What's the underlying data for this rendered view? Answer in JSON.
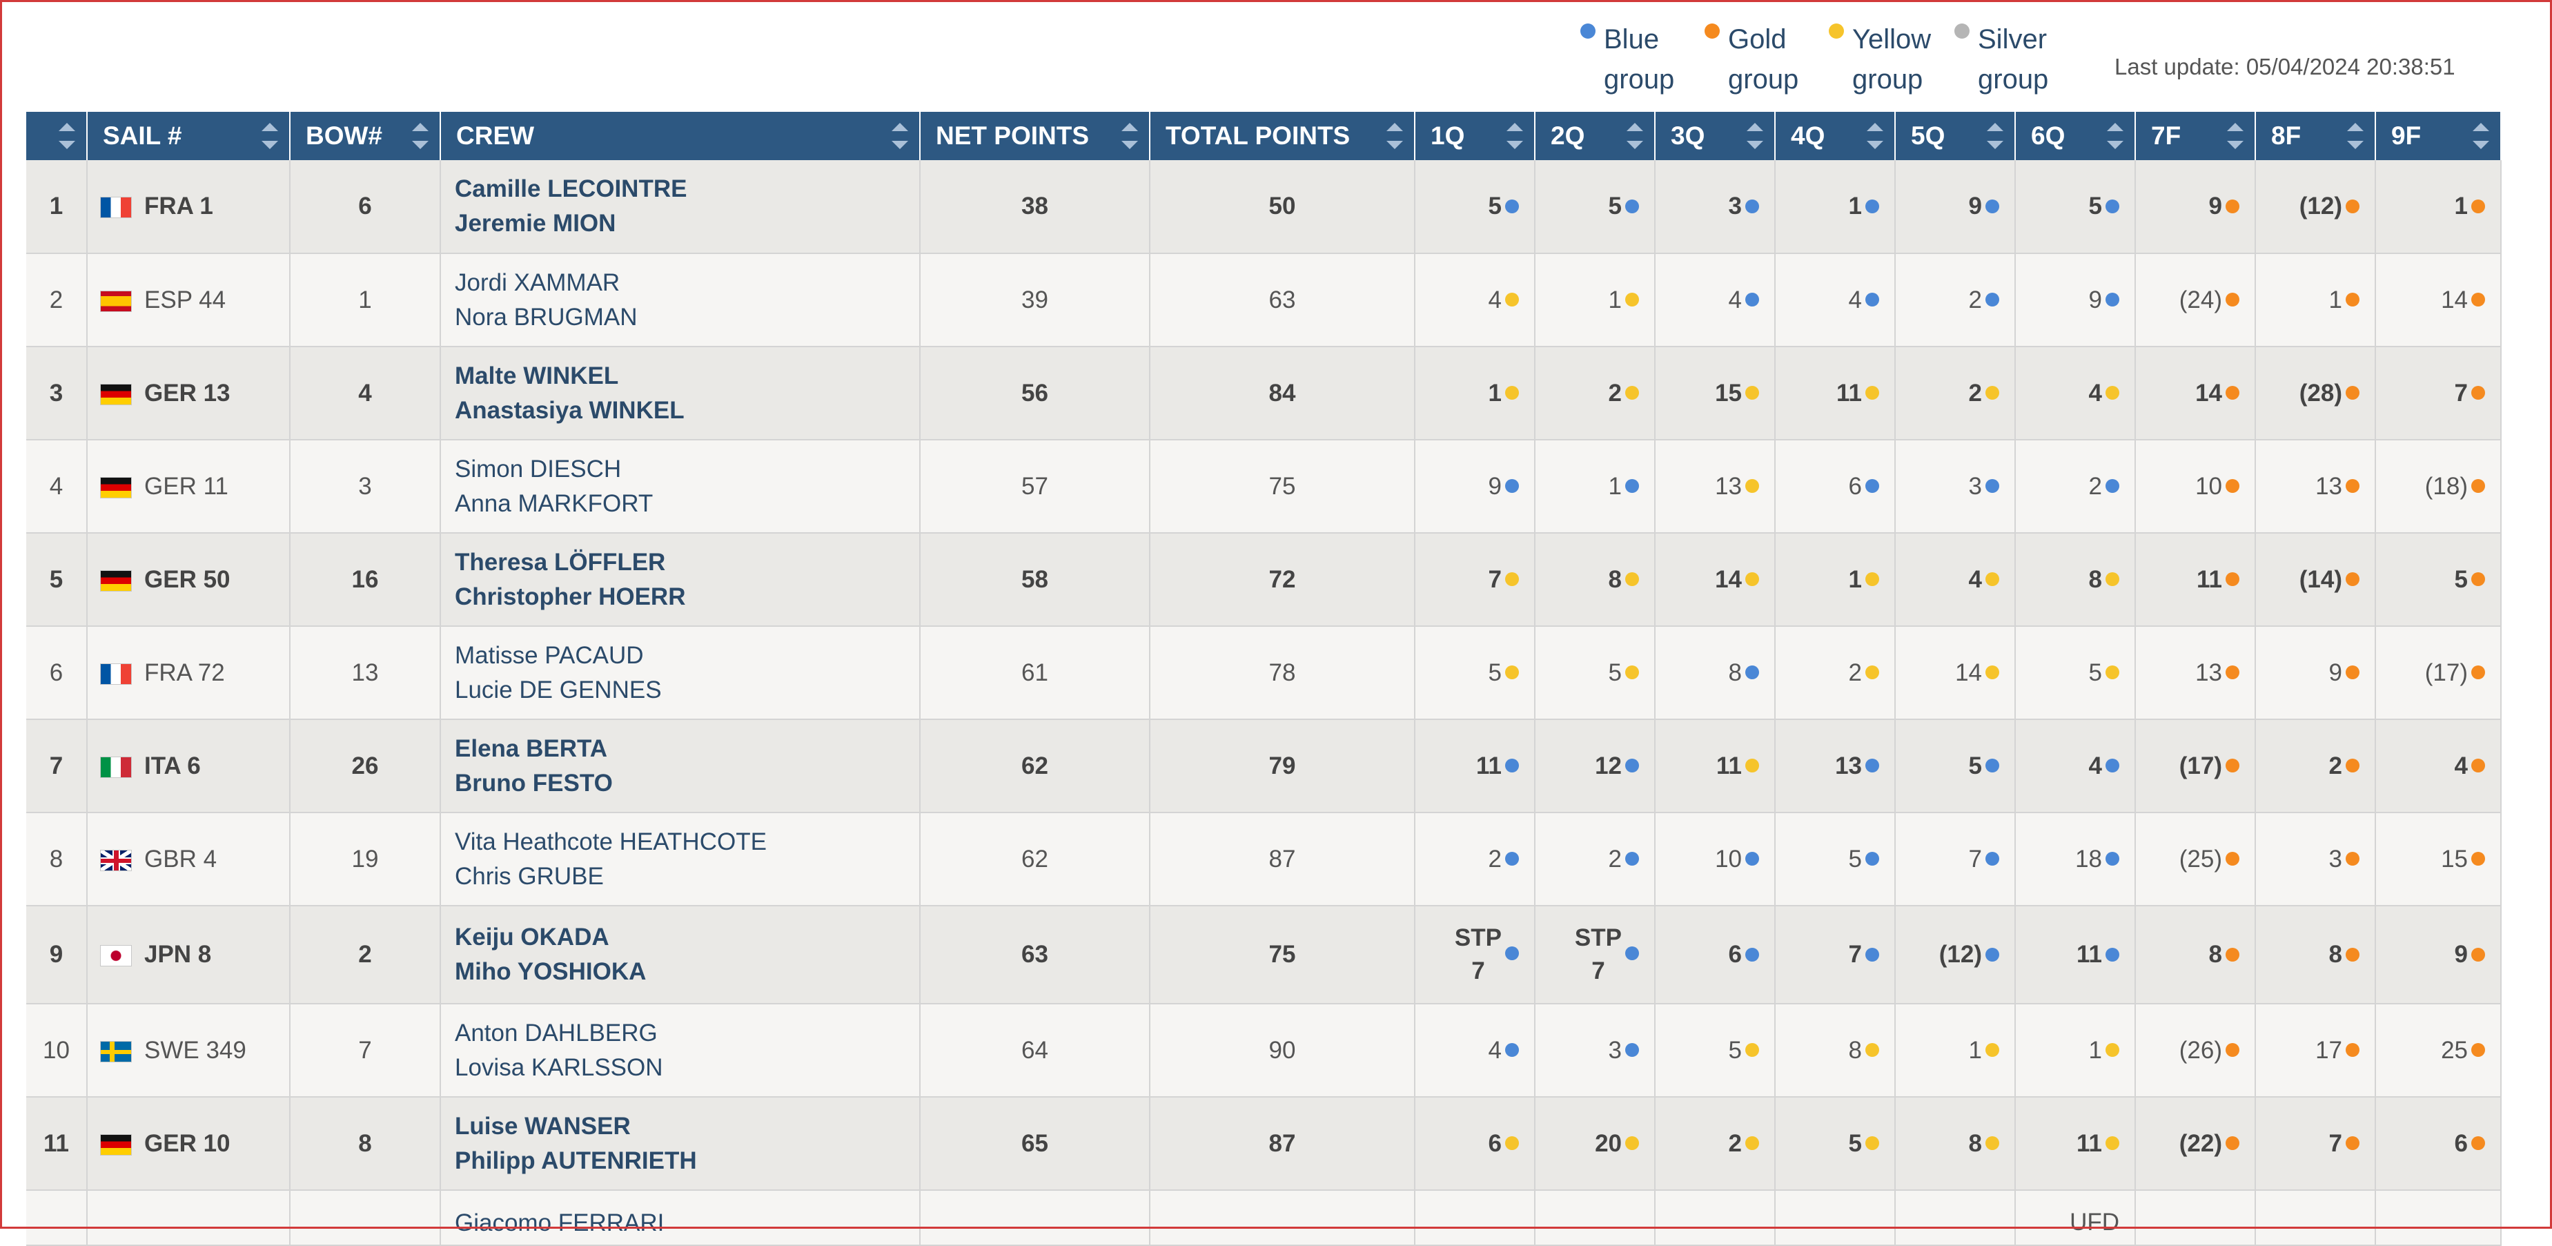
{
  "colors": {
    "header_bg": "#2d5882",
    "blue": "#4a87d6",
    "gold": "#f58a1f",
    "yellow": "#f6c42b",
    "silver": "#b5b5b5",
    "crew_text": "#2b4a6a"
  },
  "legend": [
    {
      "icon": "blue-dot",
      "line1": "Blue",
      "line2": "group",
      "color": "#4a87d6"
    },
    {
      "icon": "gold-dot",
      "line1": "Gold",
      "line2": "group",
      "color": "#f58a1f"
    },
    {
      "icon": "yellow-dot",
      "line1": "Yellow",
      "line2": "group",
      "color": "#f6c42b"
    },
    {
      "icon": "silver-dot",
      "line1": "Silver",
      "line2": "group",
      "color": "#b5b5b5"
    }
  ],
  "last_update": "Last update: 05/04/2024 20:38:51",
  "table": {
    "headers": [
      "",
      "SAIL #",
      "BOW#",
      "CREW",
      "NET POINTS",
      "TOTAL POINTS",
      "1Q",
      "2Q",
      "3Q",
      "4Q",
      "5Q",
      "6Q",
      "7F",
      "8F",
      "9F"
    ],
    "rows": [
      {
        "rank": "1",
        "flag": "fra",
        "sail": "FRA 1",
        "bow": "6",
        "crew": [
          "Camille LECOINTRE",
          "Jeremie MION"
        ],
        "net": "38",
        "total": "50",
        "races": [
          [
            "5",
            "blue"
          ],
          [
            "5",
            "blue"
          ],
          [
            "3",
            "blue"
          ],
          [
            "1",
            "blue"
          ],
          [
            "9",
            "blue"
          ],
          [
            "5",
            "blue"
          ],
          [
            "9",
            "gold"
          ],
          [
            "(12)",
            "gold"
          ],
          [
            "1",
            "gold"
          ]
        ]
      },
      {
        "rank": "2",
        "flag": "esp",
        "sail": "ESP 44",
        "bow": "1",
        "crew": [
          "Jordi XAMMAR",
          "Nora BRUGMAN"
        ],
        "net": "39",
        "total": "63",
        "races": [
          [
            "4",
            "yellow"
          ],
          [
            "1",
            "yellow"
          ],
          [
            "4",
            "blue"
          ],
          [
            "4",
            "blue"
          ],
          [
            "2",
            "blue"
          ],
          [
            "9",
            "blue"
          ],
          [
            "(24)",
            "gold"
          ],
          [
            "1",
            "gold"
          ],
          [
            "14",
            "gold"
          ]
        ]
      },
      {
        "rank": "3",
        "flag": "ger",
        "sail": "GER 13",
        "bow": "4",
        "crew": [
          "Malte WINKEL",
          "Anastasiya WINKEL"
        ],
        "net": "56",
        "total": "84",
        "races": [
          [
            "1",
            "yellow"
          ],
          [
            "2",
            "yellow"
          ],
          [
            "15",
            "yellow"
          ],
          [
            "11",
            "yellow"
          ],
          [
            "2",
            "yellow"
          ],
          [
            "4",
            "yellow"
          ],
          [
            "14",
            "gold"
          ],
          [
            "(28)",
            "gold"
          ],
          [
            "7",
            "gold"
          ]
        ]
      },
      {
        "rank": "4",
        "flag": "ger",
        "sail": "GER 11",
        "bow": "3",
        "crew": [
          "Simon DIESCH",
          "Anna MARKFORT"
        ],
        "net": "57",
        "total": "75",
        "races": [
          [
            "9",
            "blue"
          ],
          [
            "1",
            "blue"
          ],
          [
            "13",
            "yellow"
          ],
          [
            "6",
            "blue"
          ],
          [
            "3",
            "blue"
          ],
          [
            "2",
            "blue"
          ],
          [
            "10",
            "gold"
          ],
          [
            "13",
            "gold"
          ],
          [
            "(18)",
            "gold"
          ]
        ]
      },
      {
        "rank": "5",
        "flag": "ger",
        "sail": "GER 50",
        "bow": "16",
        "crew": [
          "Theresa LÖFFLER",
          "Christopher HOERR"
        ],
        "net": "58",
        "total": "72",
        "races": [
          [
            "7",
            "yellow"
          ],
          [
            "8",
            "yellow"
          ],
          [
            "14",
            "yellow"
          ],
          [
            "1",
            "yellow"
          ],
          [
            "4",
            "yellow"
          ],
          [
            "8",
            "yellow"
          ],
          [
            "11",
            "gold"
          ],
          [
            "(14)",
            "gold"
          ],
          [
            "5",
            "gold"
          ]
        ]
      },
      {
        "rank": "6",
        "flag": "fra",
        "sail": "FRA 72",
        "bow": "13",
        "crew": [
          "Matisse PACAUD",
          "Lucie DE GENNES"
        ],
        "net": "61",
        "total": "78",
        "races": [
          [
            "5",
            "yellow"
          ],
          [
            "5",
            "yellow"
          ],
          [
            "8",
            "blue"
          ],
          [
            "2",
            "yellow"
          ],
          [
            "14",
            "yellow"
          ],
          [
            "5",
            "yellow"
          ],
          [
            "13",
            "gold"
          ],
          [
            "9",
            "gold"
          ],
          [
            "(17)",
            "gold"
          ]
        ]
      },
      {
        "rank": "7",
        "flag": "ita",
        "sail": "ITA 6",
        "bow": "26",
        "crew": [
          "Elena BERTA",
          "Bruno FESTO"
        ],
        "net": "62",
        "total": "79",
        "races": [
          [
            "11",
            "blue"
          ],
          [
            "12",
            "blue"
          ],
          [
            "11",
            "yellow"
          ],
          [
            "13",
            "blue"
          ],
          [
            "5",
            "blue"
          ],
          [
            "4",
            "blue"
          ],
          [
            "(17)",
            "gold"
          ],
          [
            "2",
            "gold"
          ],
          [
            "4",
            "gold"
          ]
        ]
      },
      {
        "rank": "8",
        "flag": "gbr",
        "sail": "GBR 4",
        "bow": "19",
        "crew": [
          "Vita Heathcote HEATHCOTE",
          "Chris GRUBE"
        ],
        "net": "62",
        "total": "87",
        "races": [
          [
            "2",
            "blue"
          ],
          [
            "2",
            "blue"
          ],
          [
            "10",
            "blue"
          ],
          [
            "5",
            "blue"
          ],
          [
            "7",
            "blue"
          ],
          [
            "18",
            "blue"
          ],
          [
            "(25)",
            "gold"
          ],
          [
            "3",
            "gold"
          ],
          [
            "15",
            "gold"
          ]
        ]
      },
      {
        "rank": "9",
        "flag": "jpn",
        "sail": "JPN 8",
        "bow": "2",
        "crew": [
          "Keiju OKADA",
          "Miho YOSHIOKA"
        ],
        "net": "63",
        "total": "75",
        "races": [
          [
            "STP 7",
            "blue"
          ],
          [
            "STP 7",
            "blue"
          ],
          [
            "6",
            "blue"
          ],
          [
            "7",
            "blue"
          ],
          [
            "(12)",
            "blue"
          ],
          [
            "11",
            "blue"
          ],
          [
            "8",
            "gold"
          ],
          [
            "8",
            "gold"
          ],
          [
            "9",
            "gold"
          ]
        ]
      },
      {
        "rank": "10",
        "flag": "swe",
        "sail": "SWE 349",
        "bow": "7",
        "crew": [
          "Anton DAHLBERG",
          "Lovisa KARLSSON"
        ],
        "net": "64",
        "total": "90",
        "races": [
          [
            "4",
            "blue"
          ],
          [
            "3",
            "blue"
          ],
          [
            "5",
            "yellow"
          ],
          [
            "8",
            "yellow"
          ],
          [
            "1",
            "yellow"
          ],
          [
            "1",
            "yellow"
          ],
          [
            "(26)",
            "gold"
          ],
          [
            "17",
            "gold"
          ],
          [
            "25",
            "gold"
          ]
        ]
      },
      {
        "rank": "11",
        "flag": "ger",
        "sail": "GER 10",
        "bow": "8",
        "crew": [
          "Luise WANSER",
          "Philipp AUTENRIETH"
        ],
        "net": "65",
        "total": "87",
        "races": [
          [
            "6",
            "yellow"
          ],
          [
            "20",
            "yellow"
          ],
          [
            "2",
            "yellow"
          ],
          [
            "5",
            "yellow"
          ],
          [
            "8",
            "yellow"
          ],
          [
            "11",
            "yellow"
          ],
          [
            "(22)",
            "gold"
          ],
          [
            "7",
            "gold"
          ],
          [
            "6",
            "gold"
          ]
        ]
      },
      {
        "rank": "",
        "flag": "",
        "sail": "",
        "bow": "",
        "crew": [
          "Giacomo FERRARI"
        ],
        "net": "",
        "total": "",
        "races": [
          [
            "",
            ""
          ],
          [
            "",
            ""
          ],
          [
            "",
            ""
          ],
          [
            "",
            ""
          ],
          [
            "",
            ""
          ],
          [
            "UFD",
            ""
          ],
          [
            "",
            ""
          ],
          [
            "",
            ""
          ],
          [
            "",
            ""
          ]
        ]
      }
    ]
  }
}
